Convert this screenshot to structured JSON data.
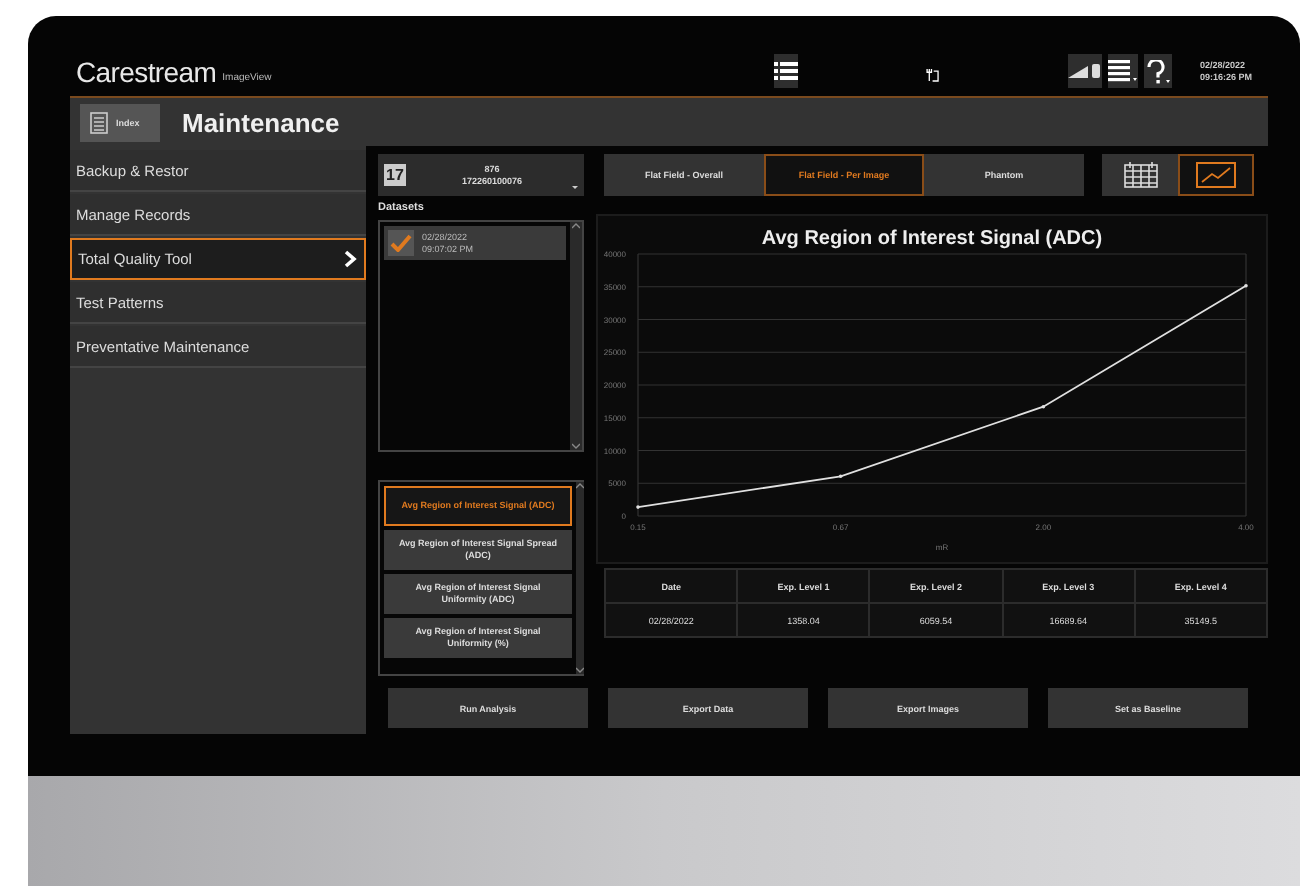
{
  "header": {
    "logo": "Carestream",
    "product": "ImageView",
    "date": "02/28/2022",
    "time": "09:16:26 PM"
  },
  "page_header": {
    "index_button": "Index",
    "title": "Maintenance"
  },
  "sidebar": {
    "items": [
      {
        "label": "Backup & Restor",
        "selected": false
      },
      {
        "label": "Manage Records",
        "selected": false
      },
      {
        "label": "Total Quality Tool",
        "selected": true
      },
      {
        "label": "Test Patterns",
        "selected": false
      },
      {
        "label": "Preventative Maintenance",
        "selected": false
      }
    ]
  },
  "study_selector": {
    "day": "17",
    "line_1": "876",
    "line_2": "172260100076"
  },
  "datasets": {
    "label": "Datasets",
    "items": [
      {
        "date": "02/28/2022",
        "time": "09:07:02 PM",
        "checked": true
      }
    ]
  },
  "metrics": [
    {
      "label": "Avg Region of Interest Signal (ADC)",
      "selected": true
    },
    {
      "label": "Avg Region of Interest Signal Spread (ADC)",
      "selected": false
    },
    {
      "label": "Avg Region of Interest Signal Uniformity (ADC)",
      "selected": false
    },
    {
      "label": "Avg Region of Interest Signal Uniformity (%)",
      "selected": false
    }
  ],
  "tabs": [
    {
      "label": "Flat Field - Overall",
      "selected": false
    },
    {
      "label": "Flat Field - Per Image",
      "selected": true
    },
    {
      "label": "Phantom",
      "selected": false
    }
  ],
  "view_toggle": [
    {
      "kind": "table",
      "selected": false
    },
    {
      "kind": "chart",
      "selected": true
    }
  ],
  "chart": {
    "chart_data": {
      "type": "line",
      "title": "Avg Region of Interest Signal (ADC)",
      "xlabel": "mR",
      "categories": [
        "0.15",
        "0.67",
        "2.00",
        "4.00"
      ],
      "series": [
        {
          "color": "#e0e0e0",
          "values": [
            1358,
            6060,
            16690,
            35150
          ]
        }
      ],
      "grid": true,
      "ylim": [
        0,
        40000
      ],
      "yticks": [
        0,
        5000,
        10000,
        15000,
        20000,
        25000,
        30000,
        35000,
        40000
      ]
    }
  },
  "table": {
    "columns": [
      "Date",
      "Exp. Level 1",
      "Exp. Level 2",
      "Exp. Level 3",
      "Exp. Level 4"
    ],
    "rows": [
      [
        "02/28/2022",
        "1358.04",
        "6059.54",
        "16689.64",
        "35149.5"
      ]
    ]
  },
  "buttons": [
    "Run Analysis",
    "Export Data",
    "Export Images",
    "Set as Baseline"
  ]
}
